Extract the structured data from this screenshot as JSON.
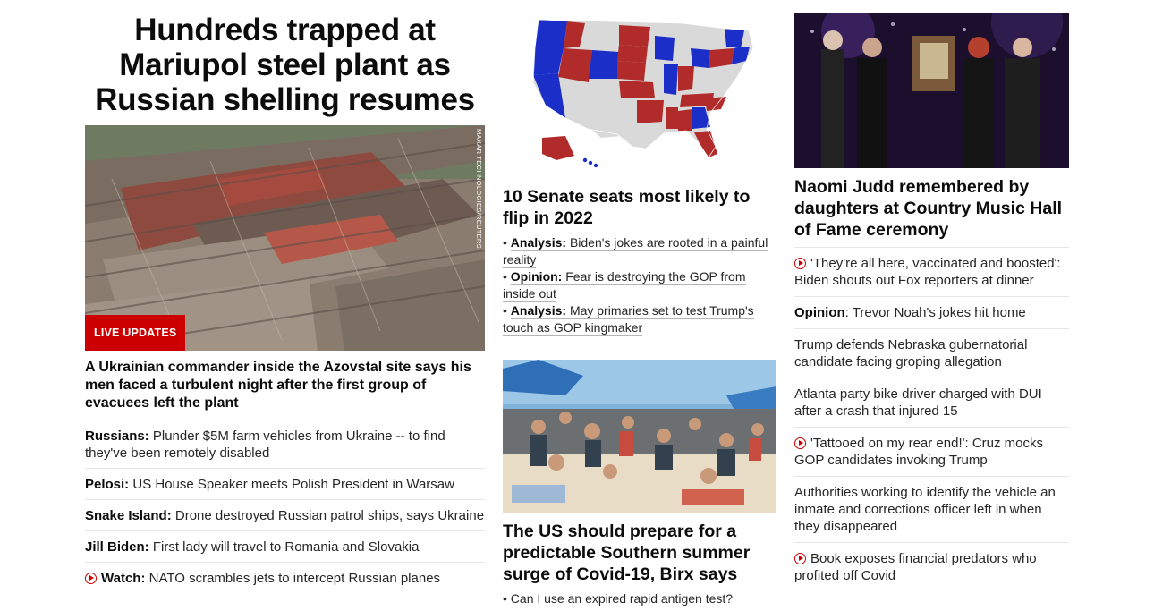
{
  "left": {
    "headline": "Hundreds trapped at Mariupol steel plant as Russian shelling resumes",
    "image_credit": "MAXAR TECHNOLOGIES/REUTERS",
    "live_badge": "LIVE UPDATES",
    "subhead": "A Ukrainian commander inside the Azovstal site says his men faced a turbulent night after the first group of evacuees left the plant",
    "items": [
      {
        "label": "Russians:",
        "text": " Plunder $5M farm vehicles from Ukraine -- to find they've been remotely disabled"
      },
      {
        "label": "Pelosi:",
        "text": " US House Speaker meets Polish President in Warsaw"
      },
      {
        "label": "Snake Island:",
        "text": " Drone destroyed Russian patrol ships, says Ukraine"
      },
      {
        "label": "Jill Biden:",
        "text": " First lady will travel to Romania and Slovakia"
      },
      {
        "label": "Watch:",
        "text": " NATO scrambles jets to intercept Russian planes"
      }
    ]
  },
  "middle": {
    "story1_title": "10 Senate seats most likely to flip in 2022",
    "bullets": [
      {
        "label": "Analysis:",
        "text": "Biden's jokes are rooted in a painful reality"
      },
      {
        "label": "Opinion:",
        "text": "Fear is destroying the GOP from inside out"
      },
      {
        "label": "Analysis:",
        "text": "May primaries set to test Trump's touch as GOP kingmaker"
      }
    ],
    "story2_title": "The US should prepare for a predictable Southern summer surge of Covid-19, Birx says",
    "story2_bullet": "Can I use an expired rapid antigen test?"
  },
  "right": {
    "title": "Naomi Judd remembered by daughters at Country Music Hall of Fame ceremony",
    "items": [
      {
        "video": true,
        "label": "",
        "text": "'They're all here, vaccinated and boosted': Biden shouts out Fox reporters at dinner"
      },
      {
        "video": false,
        "label": "Opinion",
        "text": ": Trevor Noah's jokes hit home"
      },
      {
        "video": false,
        "label": "",
        "text": "Trump defends Nebraska gubernatorial candidate facing groping allegation"
      },
      {
        "video": false,
        "label": "",
        "text": "Atlanta party bike driver charged with DUI after a crash that injured 15"
      },
      {
        "video": true,
        "label": "",
        "text": "'Tattooed on my rear end!': Cruz mocks GOP candidates invoking Trump"
      },
      {
        "video": false,
        "label": "",
        "text": "Authorities working to identify the vehicle an inmate and corrections officer left in when they disappeared"
      },
      {
        "video": true,
        "label": "",
        "text": "Book exposes financial predators who profited off Covid"
      }
    ]
  },
  "colors": {
    "accent_red": "#cc0000",
    "map_red": "#b22b2b",
    "map_blue": "#1b2fc8",
    "map_gray": "#d9d9d9"
  }
}
